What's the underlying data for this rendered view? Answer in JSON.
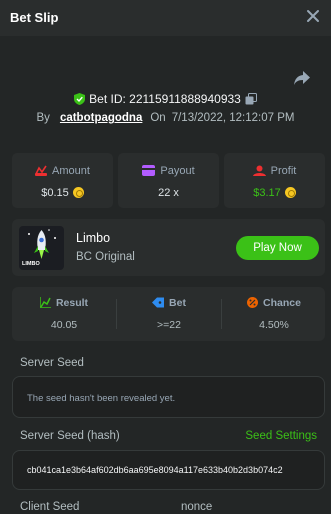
{
  "header": {
    "title": "Bet Slip"
  },
  "bet": {
    "id_label": "Bet ID:",
    "id_value": "22115911888940933",
    "by_label": "By",
    "username": "catbotpagodna",
    "on_label": "On",
    "datetime": "7/13/2022, 12:12:07 PM"
  },
  "stats": [
    {
      "label": "Amount",
      "value": "$0.15",
      "icon": "amount-icon",
      "color": "#ed6300"
    },
    {
      "label": "Payout",
      "value": "22 x",
      "icon": "payout-icon",
      "color": "#b25cff"
    },
    {
      "label": "Profit",
      "value": "$3.17",
      "icon": "profit-icon",
      "color": "#ed2f30"
    }
  ],
  "game": {
    "name": "Limbo",
    "provider": "BC Original",
    "thumb_text": "LIMBO",
    "play_label": "Play Now"
  },
  "result": [
    {
      "label": "Result",
      "value": "40.05",
      "icon": "result-icon",
      "color": "#3bc117"
    },
    {
      "label": "Bet",
      "value": ">=22",
      "icon": "bet-icon",
      "color": "#2e8cf0"
    },
    {
      "label": "Chance",
      "value": "4.50%",
      "icon": "chance-icon",
      "color": "#ed6300"
    }
  ],
  "seeds": {
    "server_seed_label": "Server Seed",
    "server_seed_placeholder": "The seed hasn't been revealed yet.",
    "server_hash_label": "Server Seed (hash)",
    "seed_settings_label": "Seed Settings",
    "server_hash_value": "cb041ca1e3b64af602db6aa695e8094a117e633b40b2d3b074c2",
    "client_seed_label": "Client Seed",
    "nonce_label": "nonce"
  },
  "colors": {
    "accent": "#3bc117",
    "profit_text": "#3bc117"
  }
}
